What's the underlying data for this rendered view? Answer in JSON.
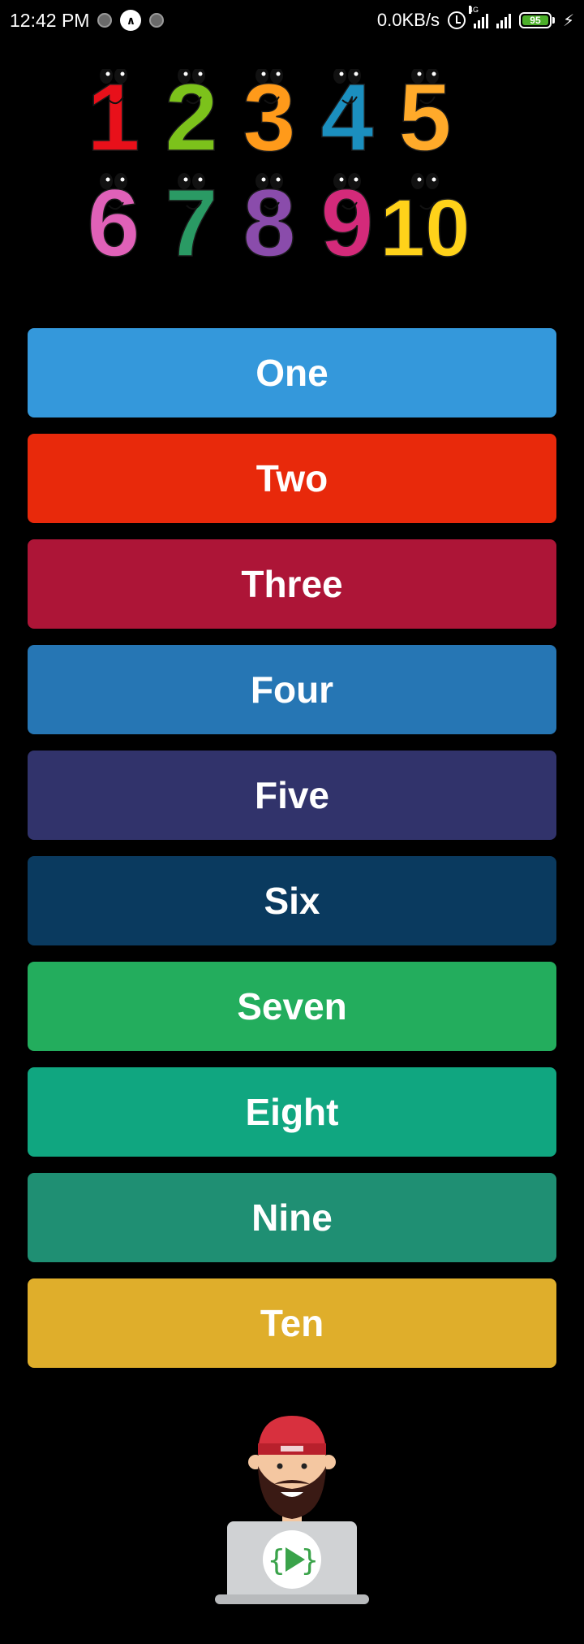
{
  "status_bar": {
    "time": "12:42 PM",
    "network_speed": "0.0KB/s",
    "network_type": "4G",
    "battery_level": "95",
    "icons": [
      "notification-dot-icon",
      "up-arrow-icon",
      "notification-dot-icon",
      "alarm-icon",
      "signal-icon",
      "signal-icon",
      "battery-icon",
      "charging-icon"
    ]
  },
  "header_image": {
    "numbers": [
      {
        "glyph": "1",
        "color": "#e8101a"
      },
      {
        "glyph": "2",
        "color": "#7cc21b"
      },
      {
        "glyph": "3",
        "color": "#ff9a1a"
      },
      {
        "glyph": "4",
        "color": "#1b8fbf"
      },
      {
        "glyph": "5",
        "color": "#ffaa2a"
      },
      {
        "glyph": "6",
        "color": "#e061b8"
      },
      {
        "glyph": "7",
        "color": "#2a9a64"
      },
      {
        "glyph": "8",
        "color": "#8a4cab"
      },
      {
        "glyph": "9",
        "color": "#d42a7a"
      },
      {
        "glyph": "10",
        "color": "#ffd21a"
      }
    ]
  },
  "buttons": [
    {
      "label": "One",
      "color": "#3498db"
    },
    {
      "label": "Two",
      "color": "#e8290b"
    },
    {
      "label": "Three",
      "color": "#ad1537"
    },
    {
      "label": "Four",
      "color": "#2676b4"
    },
    {
      "label": "Five",
      "color": "#31336b"
    },
    {
      "label": "Six",
      "color": "#0a3a5f"
    },
    {
      "label": "Seven",
      "color": "#23ad5d"
    },
    {
      "label": "Eight",
      "color": "#10a680"
    },
    {
      "label": "Nine",
      "color": "#1f8f73"
    },
    {
      "label": "Ten",
      "color": "#dfae2b"
    }
  ]
}
